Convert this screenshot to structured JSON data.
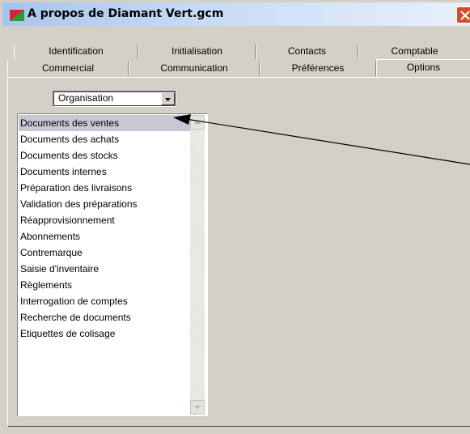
{
  "window": {
    "title": "A propos de Diamant Vert.gcm",
    "icon": "app-icon"
  },
  "tabs": {
    "row1": [
      "Identification",
      "Initialisation",
      "Contacts",
      "Comptable"
    ],
    "row2": [
      "Commercial",
      "Communication",
      "Préférences",
      "Options"
    ],
    "selected": "Options"
  },
  "combo": {
    "value": "Organisation"
  },
  "list": {
    "items": [
      "Documents des ventes",
      "Documents des achats",
      "Documents des stocks",
      "Documents internes",
      "Préparation des livraisons",
      "Validation des préparations",
      "Réapprovisionnement",
      "Abonnements",
      "Contremarque",
      "Saisie d'inventaire",
      "Règlements",
      "Interrogation de comptes",
      "Recherche de documents",
      "Etiquettes de colisage"
    ],
    "selected_index": 0
  },
  "colors": {
    "window_bg": "#d4d0c8",
    "selection": "#c8c8d4",
    "close_button": "#d64a2a"
  }
}
